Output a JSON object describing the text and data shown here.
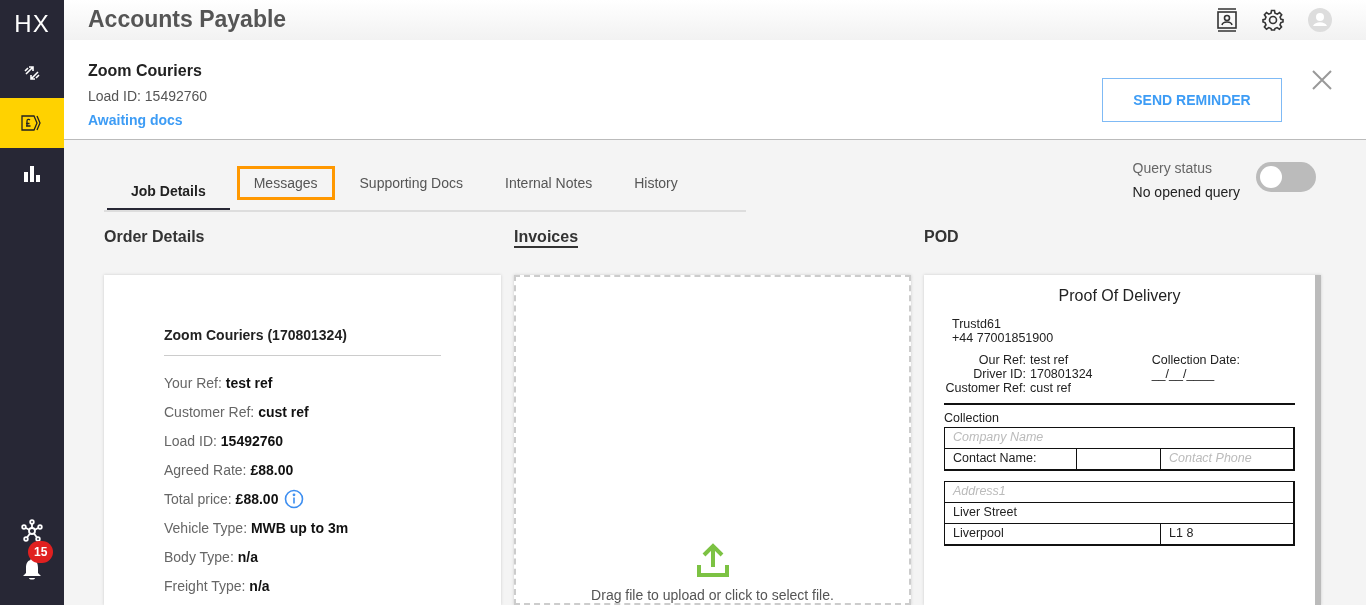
{
  "app": {
    "logo": "HX",
    "title": "Accounts Payable"
  },
  "sidebar": {
    "items": [
      {
        "kind": "transfer",
        "selected": false
      },
      {
        "kind": "invoice",
        "selected": true
      },
      {
        "kind": "chart",
        "selected": false
      }
    ],
    "notification_count": "15"
  },
  "header": {
    "company": "Zoom Couriers",
    "load_id": "Load ID: 15492760",
    "status": "Awaiting docs",
    "button": "SEND REMINDER"
  },
  "tabs": [
    {
      "label": "Job Details",
      "selected": true,
      "highlighted": false
    },
    {
      "label": "Messages",
      "selected": false,
      "highlighted": true
    },
    {
      "label": "Supporting Docs",
      "selected": false,
      "highlighted": false
    },
    {
      "label": "Internal Notes",
      "selected": false,
      "highlighted": false
    },
    {
      "label": "History",
      "selected": false,
      "highlighted": false
    }
  ],
  "query": {
    "label": "Query status",
    "value": "No opened query",
    "on": false
  },
  "order_details": {
    "heading": "Order Details",
    "title": "Zoom Couriers (170801324)",
    "fields": [
      {
        "label": "Your Ref:",
        "value": "test ref",
        "info": false
      },
      {
        "label": "Customer Ref:",
        "value": "cust ref",
        "info": false
      },
      {
        "label": "Load ID:",
        "value": "15492760",
        "info": false
      },
      {
        "label": "Agreed Rate:",
        "value": "£88.00",
        "info": false
      },
      {
        "label": "Total price:",
        "value": "£88.00",
        "info": true
      },
      {
        "label": "Vehicle Type:",
        "value": "MWB up to 3m",
        "info": false
      },
      {
        "label": "Body Type:",
        "value": "n/a",
        "info": false
      },
      {
        "label": "Freight Type:",
        "value": "n/a",
        "info": false
      }
    ]
  },
  "invoices": {
    "heading": "Invoices",
    "hint": "Drag file to upload or click to select file."
  },
  "pod": {
    "heading": "POD",
    "title": "Proof Of Delivery",
    "sender": [
      "Trustd61",
      "+44 77001851900"
    ],
    "refs": [
      {
        "label": "Our Ref:",
        "value": "test ref",
        "extra": "Collection Date:"
      },
      {
        "label": "Driver ID:",
        "value": "170801324",
        "extra": "__/__/____"
      },
      {
        "label": "Customer Ref:",
        "value": "cust ref"
      }
    ],
    "section": "Collection",
    "tables": [
      [
        [
          {
            "kind": "hint",
            "text": "Company Name"
          }
        ],
        [
          {
            "kind": "value",
            "text": "Contact Name:"
          },
          {
            "kind": "blank"
          },
          {
            "kind": "hint",
            "text": "Contact Phone"
          }
        ]
      ],
      [
        [
          {
            "kind": "hint",
            "text": "Address1"
          }
        ],
        [
          {
            "kind": "value",
            "text": "Liver Street"
          }
        ],
        [
          {
            "kind": "value",
            "text": "Liverpool"
          },
          {
            "kind": "value",
            "text": "L1 8"
          }
        ]
      ]
    ]
  }
}
